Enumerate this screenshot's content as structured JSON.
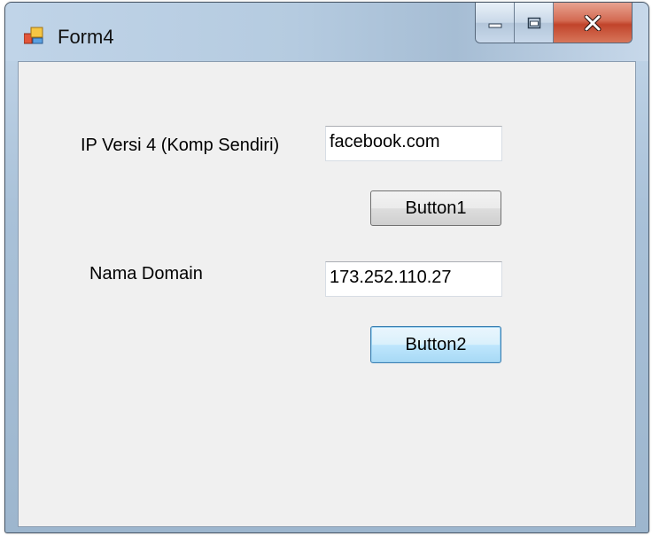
{
  "window": {
    "title": "Form4",
    "icon": "form-app-icon",
    "caption_buttons": [
      "minimize-icon",
      "restore-icon",
      "close-icon"
    ]
  },
  "form": {
    "ip_label": "IP Versi 4 (Komp Sendiri)",
    "ip_value": "facebook.com",
    "button1_label": "Button1",
    "domain_label": "Nama Domain",
    "domain_value": "173.252.110.27",
    "button2_label": "Button2"
  },
  "colors": {
    "client_background": "#f0f0f0",
    "close_button": "#c1442b",
    "focused_button_border": "#3c7fb1"
  }
}
